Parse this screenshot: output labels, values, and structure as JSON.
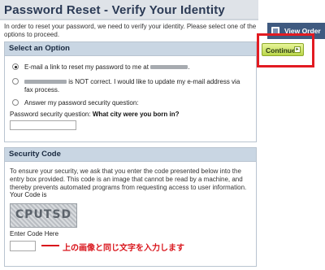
{
  "page": {
    "title": "Password Reset - Verify Your Identity",
    "intro": "In order to reset your password, we need to verify your identity. Please select one of the options to proceed."
  },
  "option_section": {
    "header": "Select an Option",
    "options": [
      {
        "text": "E-mail a link to reset my password to me at",
        "suffix": ".",
        "checked": true
      },
      {
        "text": "is NOT correct. I would like to update my e-mail address via fax process.",
        "checked": false
      },
      {
        "text": "Answer my password security question:",
        "checked": false
      }
    ],
    "security_question_label": "Password security question:",
    "security_question": "What city were you born in?",
    "answer_value": ""
  },
  "code_section": {
    "header": "Security Code",
    "description": "To ensure your security, we ask that you enter the code presented below into the entry box provided. This code is an image that cannot be read by a machine, and thereby prevents automated programs from requesting access to user information.",
    "your_code_label": "Your Code is",
    "captcha_text": "CPUTSD",
    "enter_label": "Enter Code Here",
    "code_value": ""
  },
  "annotation": {
    "text": "上の画像と同じ文字を入力します",
    "color": "#d9141b"
  },
  "sidebar": {
    "view_order_label": "View Order",
    "continue_label": "Continue"
  }
}
